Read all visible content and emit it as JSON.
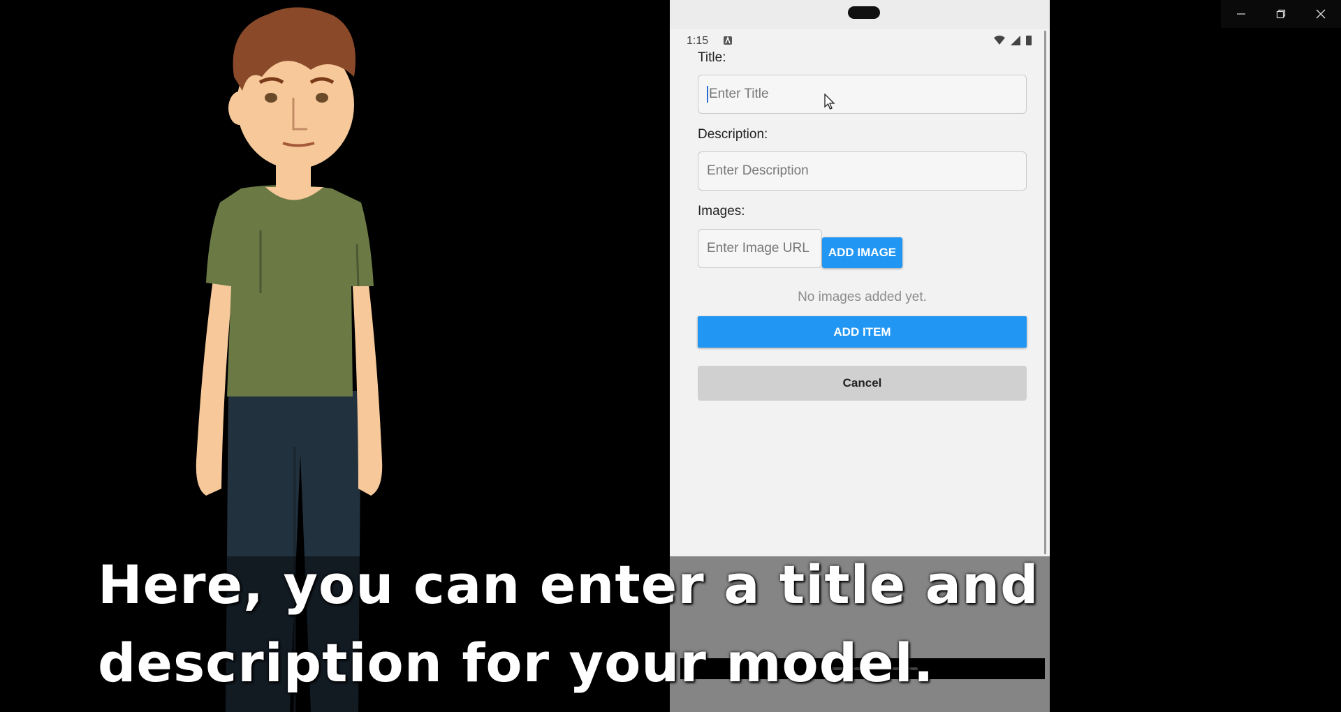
{
  "window": {
    "controls": [
      "minimize",
      "restore",
      "close"
    ]
  },
  "phone": {
    "status_time": "1:15",
    "form": {
      "title_label": "Title:",
      "title_placeholder": "Enter Title",
      "description_label": "Description:",
      "description_placeholder": "Enter Description",
      "images_label": "Images:",
      "image_url_placeholder": "Enter Image URL",
      "add_image_button": "ADD IMAGE",
      "empty_images_text": "No images added yet.",
      "add_item_button": "ADD ITEM",
      "cancel_button": "Cancel"
    }
  },
  "caption": {
    "text": "Here, you can enter a title and description for your model."
  },
  "colors": {
    "accent": "#2196f3",
    "cancel": "#d0d0d0",
    "shirt": "#6b7a45",
    "pants": "#22313e"
  }
}
